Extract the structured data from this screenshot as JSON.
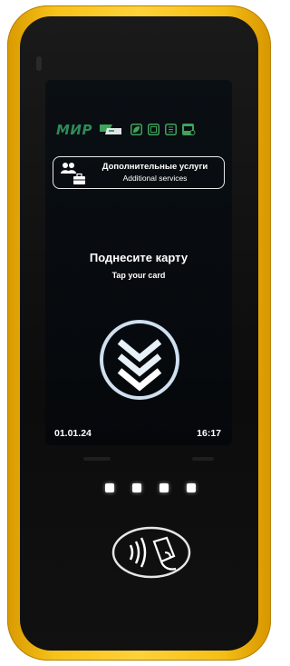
{
  "brand": {
    "payment_logo": "МИР",
    "icons": [
      "bank-card-icon",
      "leaf-icon",
      "media-icon",
      "receipt-icon",
      "cash-icon"
    ]
  },
  "services": {
    "label_ru": "Дополнительные услуги",
    "label_en": "Additional services",
    "icons": [
      "people-icon",
      "briefcase-icon"
    ]
  },
  "prompt": {
    "title": "Поднесите карту",
    "subtitle": "Tap your card"
  },
  "status": {
    "date": "01.01.24",
    "time": "16:17"
  },
  "indicator_lights": 4,
  "reader": {
    "icon": "contactless-nfc-icon"
  },
  "colors": {
    "body": "#f4be15",
    "screen": "#05080b",
    "accent_green": "#3fa35a",
    "text": "#ffffff",
    "arrows": "#e8f0f8"
  }
}
